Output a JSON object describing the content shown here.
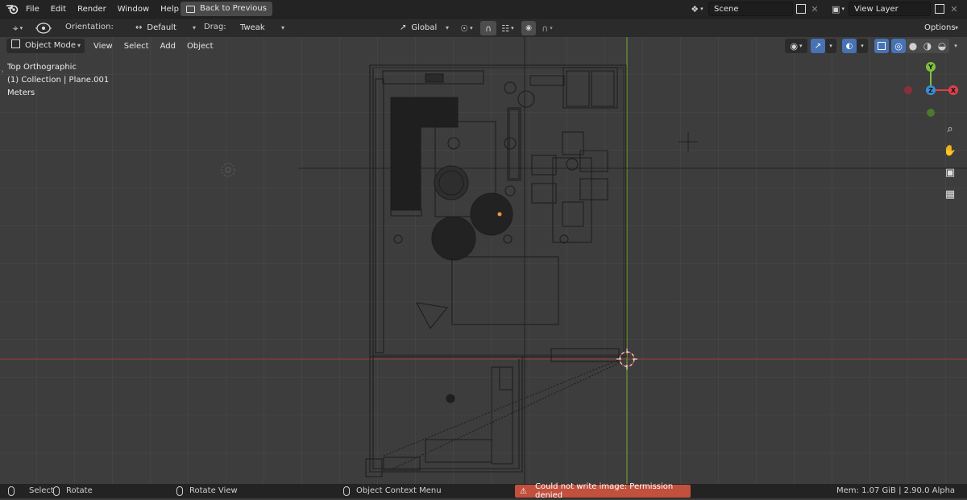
{
  "topbar": {
    "menus": [
      "File",
      "Edit",
      "Render",
      "Window",
      "Help"
    ],
    "back_button": "Back to Previous",
    "scene_label": "Scene",
    "view_layer_label": "View Layer"
  },
  "toolbar": {
    "orientation_label": "Orientation:",
    "orientation_value": "Default",
    "drag_label": "Drag:",
    "drag_value": "Tweak",
    "transform_space": "Global",
    "options_label": "Options"
  },
  "view_header": {
    "mode": "Object Mode",
    "menus": [
      "View",
      "Select",
      "Add",
      "Object"
    ]
  },
  "overlay": {
    "view_name": "Top Orthographic",
    "collection_info": "(1) Collection | Plane.001",
    "units": "Meters"
  },
  "gizmo": {
    "x": "X",
    "y": "Y",
    "z": "Z",
    "colors": {
      "x": "#e0404a",
      "y": "#7cc23a",
      "z": "#3a8ed6",
      "neg_x": "#8a2f3a",
      "neg_y": "#4a7a2e"
    }
  },
  "statusbar": {
    "select": "Select",
    "rotate": "Rotate",
    "rotate_view": "Rotate View",
    "context_menu": "Object Context Menu",
    "warning": "Could not write image: Permission denied",
    "mem": "Mem: 1.07 GiB | 2.90.0 Alpha"
  },
  "icons": [
    "blender-logo-icon",
    "cursor-tool-icon",
    "pivot-icon",
    "transform-space-icon",
    "snap-icon",
    "magnet-icon",
    "proportional-edit-icon",
    "scene-icon",
    "copy-icon",
    "close-icon",
    "view-layer-icon",
    "object-mode-icon",
    "visibility-icon",
    "gizmo-icon",
    "overlay-icon",
    "xray-icon",
    "wireframe-shading-icon",
    "solid-shading-icon",
    "material-shading-icon",
    "rendered-shading-icon",
    "zoom-icon",
    "hand-pan-icon",
    "camera-icon",
    "grid-icon",
    "warning-icon"
  ]
}
